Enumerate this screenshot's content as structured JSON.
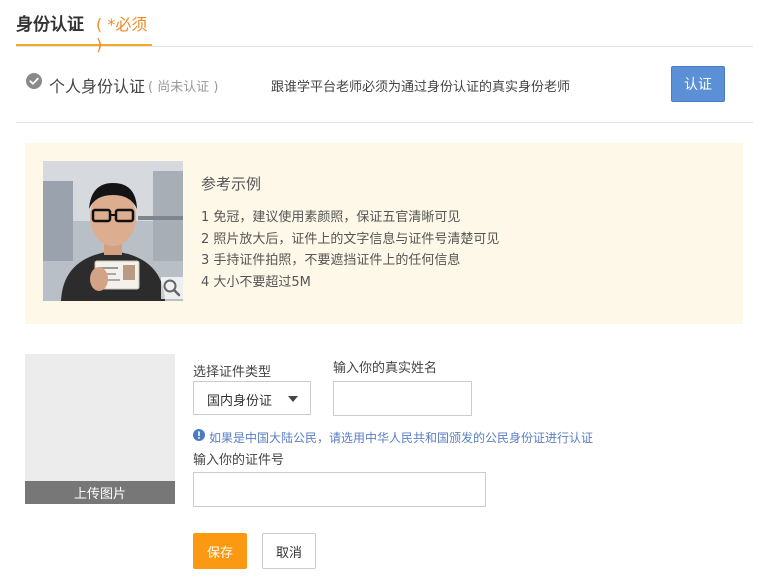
{
  "tab": {
    "title": "身份认证",
    "required": "( *必须 )"
  },
  "auth": {
    "name": "个人身份认证",
    "status": "( 尚未认证 )",
    "description": "跟谁学平台老师必须为通过身份认证的真实身份老师",
    "verify_label": "认证"
  },
  "example": {
    "title": "参考示例",
    "tips": [
      "1 免冠，建议使用素颜照，保证五官清晰可见",
      "2 照片放大后，证件上的文字信息与证件号清楚可见",
      "3 手持证件拍照，不要遮挡证件上的任何信息",
      "4 大小不要超过5M"
    ]
  },
  "upload": {
    "label": "上传图片"
  },
  "form": {
    "id_type_label": "选择证件类型",
    "id_type_value": "国内身份证",
    "name_label": "输入你的真实姓名",
    "name_value": "",
    "notice": "如果是中国大陆公民，请选用中华人民共和国颁发的公民身份证进行认证",
    "id_number_label": "输入你的证件号",
    "id_number_value": ""
  },
  "actions": {
    "save_label": "保存",
    "cancel_label": "取消"
  },
  "colors": {
    "accent": "#f5a623",
    "required": "#f08a24",
    "verify_button": "#5b8fd6",
    "save_button": "#fb9a12",
    "example_bg": "#fef8e8",
    "notice": "#5b7fc4"
  }
}
